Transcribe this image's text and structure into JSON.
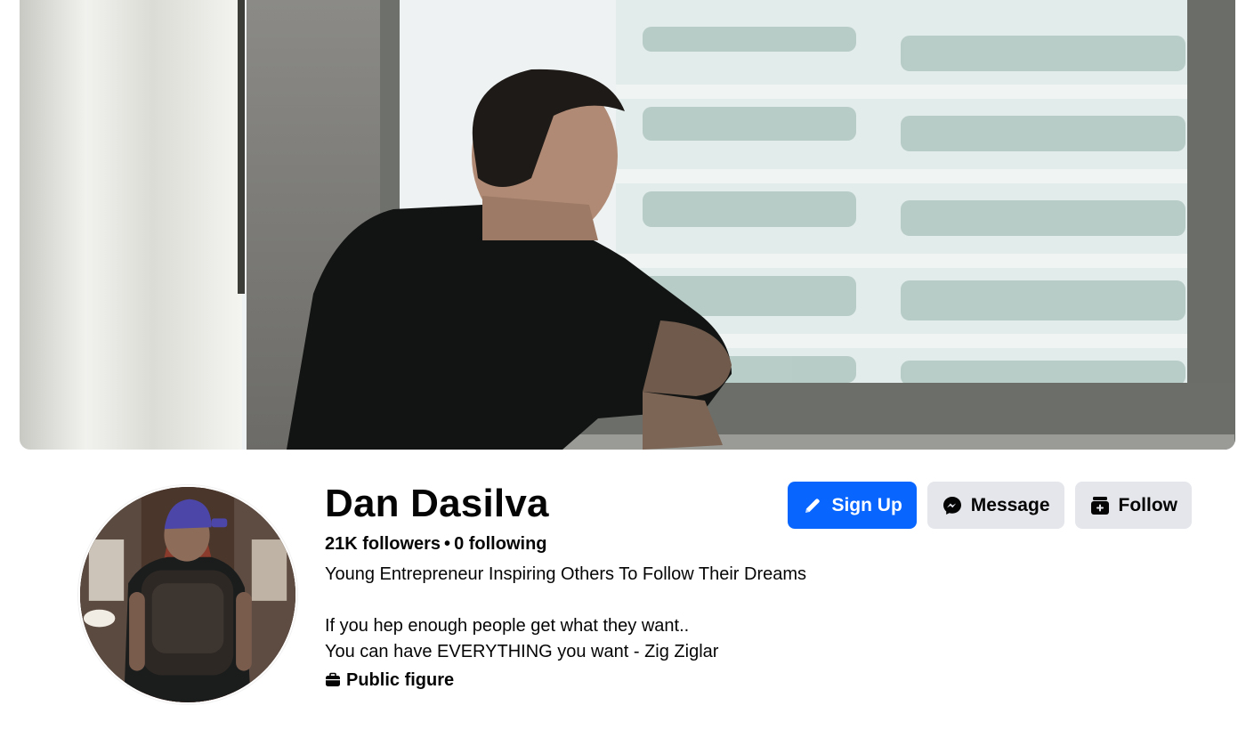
{
  "profile": {
    "name": "Dan Dasilva",
    "followers": "21K followers",
    "separator": "•",
    "following": "0 following",
    "bio": "Young Entrepreneur Inspiring Others To Follow Their Dreams\n\nIf you hep enough people get what they want..\nYou can have EVERYTHING you want - Zig Ziglar",
    "category": "Public figure",
    "category_icon": "briefcase-icon"
  },
  "actions": {
    "sign_up_label": "Sign Up",
    "sign_up_icon": "pencil-icon",
    "message_label": "Message",
    "message_icon": "messenger-icon",
    "follow_label": "Follow",
    "follow_icon": "follow-add-icon"
  },
  "colors": {
    "primary": "#0866ff",
    "secondary_button": "#e4e6eb",
    "text": "#050505"
  }
}
